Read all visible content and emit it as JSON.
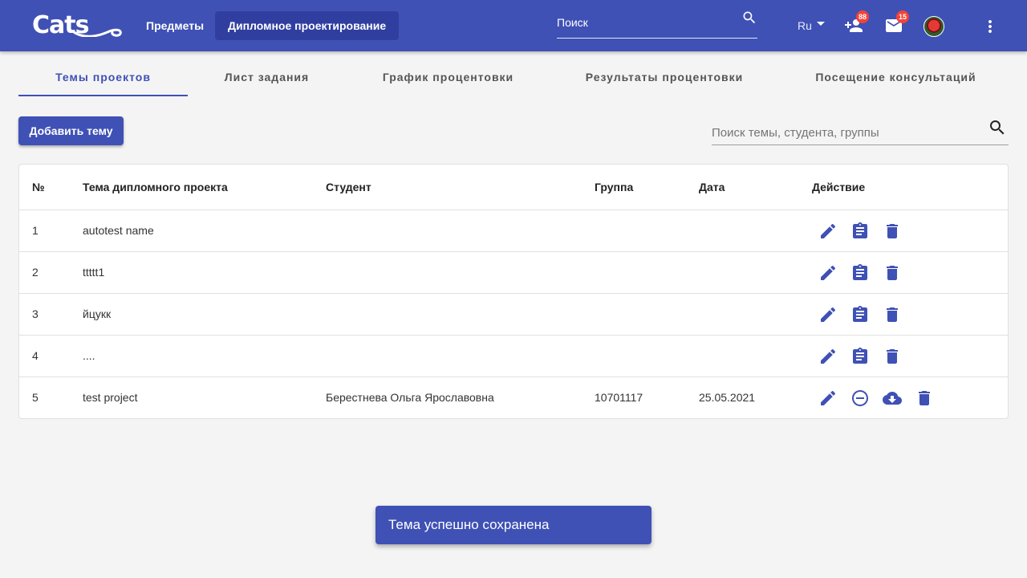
{
  "header": {
    "logo_text": "Cats",
    "nav": {
      "subjects": "Предметы",
      "diploma": "Дипломное проектирование"
    },
    "search_placeholder": "Поиск",
    "language": "Ru",
    "notifications_count": "88",
    "messages_count": "15"
  },
  "tabs": [
    {
      "label": "Темы проектов",
      "active": true
    },
    {
      "label": "Лист задания"
    },
    {
      "label": "График процентовки"
    },
    {
      "label": "Результаты процентовки"
    },
    {
      "label": "Посещение консультаций"
    }
  ],
  "toolbar": {
    "add_label": "Добавить тему",
    "search_placeholder": "Поиск темы, студента, группы"
  },
  "table": {
    "columns": [
      "№",
      "Тема дипломного проекта",
      "Студент",
      "Группа",
      "Дата",
      "Действие"
    ],
    "rows": [
      {
        "num": "1",
        "topic": "autotest name",
        "student": "",
        "group": "",
        "date": "",
        "actions": [
          "edit-icon",
          "assignment-icon",
          "delete-icon"
        ]
      },
      {
        "num": "2",
        "topic": "ttttt1",
        "student": "",
        "group": "",
        "date": "",
        "actions": [
          "edit-icon",
          "assignment-icon",
          "delete-icon"
        ]
      },
      {
        "num": "3",
        "topic": "йцукк",
        "student": "",
        "group": "",
        "date": "",
        "actions": [
          "edit-icon",
          "assignment-icon",
          "delete-icon"
        ]
      },
      {
        "num": "4",
        "topic": "....",
        "student": "",
        "group": "",
        "date": "",
        "actions": [
          "edit-icon",
          "assignment-icon",
          "delete-icon"
        ]
      },
      {
        "num": "5",
        "topic": "test project",
        "student": "Берестнева Ольга Ярославовна",
        "group": "10701117",
        "date": "25.05.2021",
        "actions": [
          "edit-icon",
          "remove-circle-icon",
          "cloud-download-icon",
          "delete-icon"
        ]
      }
    ]
  },
  "snackbar": {
    "message": "Тема успешно сохранена"
  },
  "colors": {
    "primary": "#3f51b5",
    "primary_dark": "#303f9f",
    "badge": "#f44336"
  }
}
